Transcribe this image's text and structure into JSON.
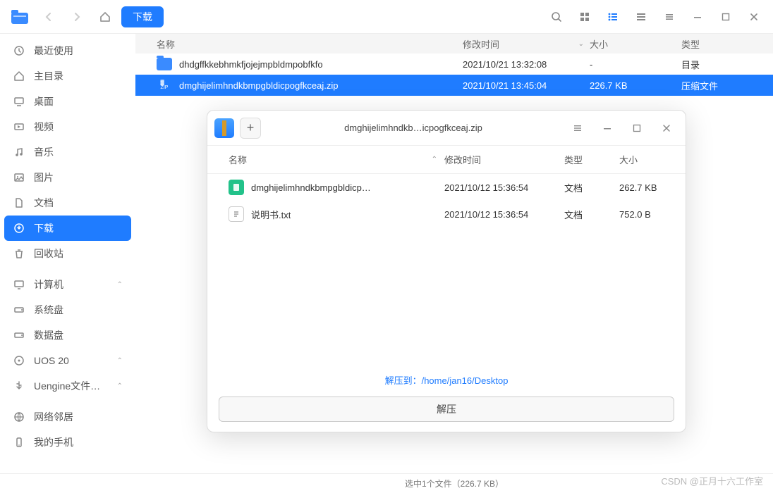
{
  "toolbar": {
    "path_label": "下载"
  },
  "sidebar": {
    "items": [
      {
        "icon": "clock",
        "label": "最近使用"
      },
      {
        "icon": "home",
        "label": "主目录"
      },
      {
        "icon": "desktop",
        "label": "桌面"
      },
      {
        "icon": "video",
        "label": "视频"
      },
      {
        "icon": "music",
        "label": "音乐"
      },
      {
        "icon": "image",
        "label": "图片"
      },
      {
        "icon": "file",
        "label": "文档"
      },
      {
        "icon": "download",
        "label": "下载",
        "active": true
      },
      {
        "icon": "trash",
        "label": "回收站"
      },
      {
        "icon": "computer",
        "label": "计算机",
        "expandable": true
      },
      {
        "icon": "disk",
        "label": "系统盘"
      },
      {
        "icon": "disk",
        "label": "数据盘"
      },
      {
        "icon": "optical",
        "label": "UOS 20",
        "expandable": true
      },
      {
        "icon": "usb",
        "label": "Uengine文件…",
        "expandable": true
      },
      {
        "icon": "network",
        "label": "网络邻居"
      },
      {
        "icon": "phone",
        "label": "我的手机"
      }
    ]
  },
  "list": {
    "columns": {
      "name": "名称",
      "mtime": "修改时间",
      "size": "大小",
      "type": "类型"
    },
    "rows": [
      {
        "kind": "folder",
        "name": "dhdgffkkebhmkfjojejmpbldmpobfkfo",
        "mtime": "2021/10/21 13:32:08",
        "size": "-",
        "type": "目录"
      },
      {
        "kind": "zip",
        "name": "dmghijelimhndkbmpgbldicpogfkceaj.zip",
        "mtime": "2021/10/21 13:45:04",
        "size": "226.7 KB",
        "type": "压缩文件",
        "selected": true
      }
    ]
  },
  "statusbar": {
    "text": "选中1个文件（226.7 KB）"
  },
  "watermark": "CSDN @正月十六工作室",
  "modal": {
    "title": "dmghijelimhndkb…icpogfkceaj.zip",
    "columns": {
      "name": "名称",
      "mtime": "修改时间",
      "type": "类型",
      "size": "大小"
    },
    "rows": [
      {
        "icon": "green",
        "name": "dmghijelimhndkbmpgbldicp…",
        "mtime": "2021/10/12 15:36:54",
        "type": "文档",
        "size": "262.7 KB"
      },
      {
        "icon": "gray",
        "name": "说明书.txt",
        "mtime": "2021/10/12 15:36:54",
        "type": "文档",
        "size": "752.0 B"
      }
    ],
    "extract_to_label": "解压到：",
    "extract_path": "/home/jan16/Desktop",
    "button": "解压"
  }
}
